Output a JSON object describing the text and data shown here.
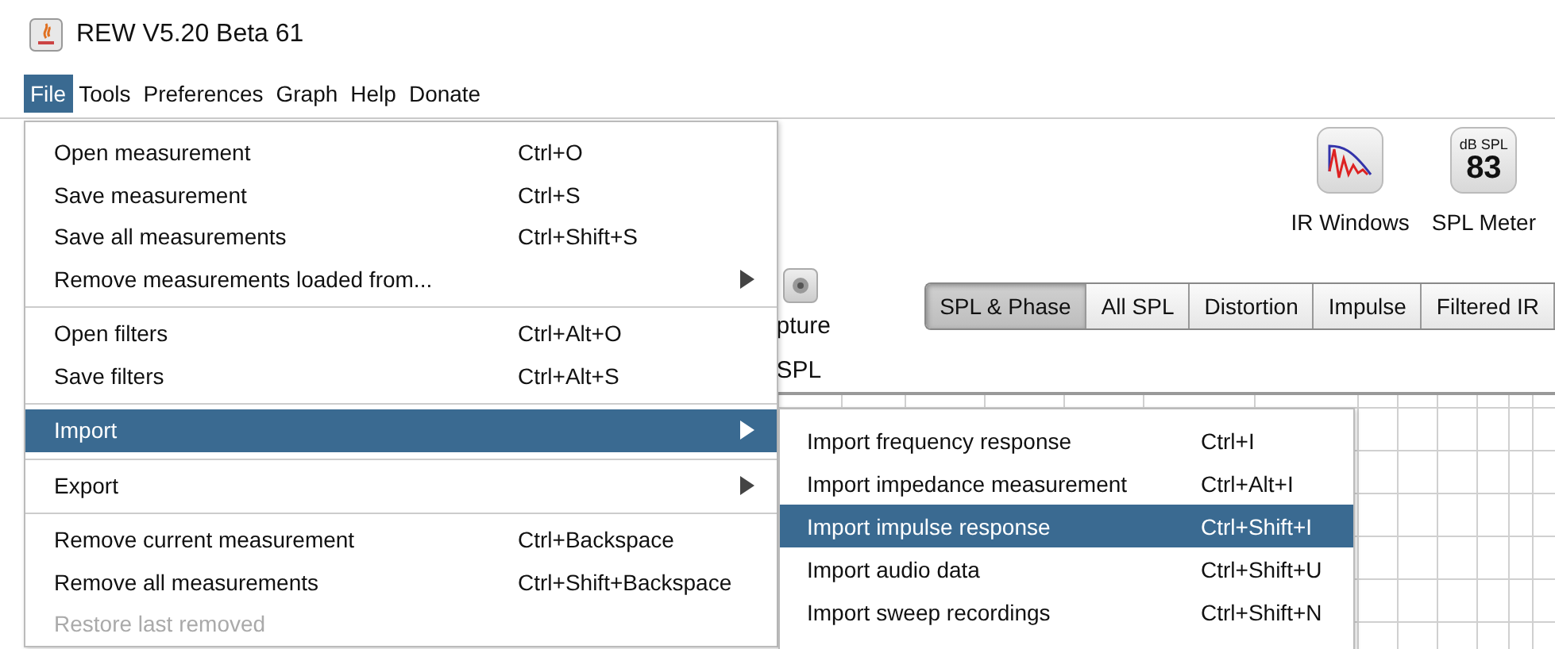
{
  "window": {
    "title": "REW V5.20 Beta 61"
  },
  "menubar": [
    {
      "label": "File",
      "selected": true
    },
    {
      "label": "Tools",
      "selected": false
    },
    {
      "label": "Preferences",
      "selected": false
    },
    {
      "label": "Graph",
      "selected": false
    },
    {
      "label": "Help",
      "selected": false
    },
    {
      "label": "Donate",
      "selected": false
    }
  ],
  "toolbar": {
    "ir_windows": {
      "label": "IR Windows"
    },
    "spl_meter": {
      "label": "SPL Meter",
      "unit": "dB SPL",
      "reading": "83"
    }
  },
  "capture": {
    "label": "pture",
    "sublabel": "SPL"
  },
  "graph_tabs": [
    {
      "label": "SPL & Phase",
      "selected": true
    },
    {
      "label": "All SPL",
      "selected": false
    },
    {
      "label": "Distortion",
      "selected": false
    },
    {
      "label": "Impulse",
      "selected": false
    },
    {
      "label": "Filtered IR",
      "selected": false
    }
  ],
  "file_menu": {
    "groups": [
      [
        {
          "label": "Open measurement",
          "shortcut": "Ctrl+O",
          "submenu": false,
          "selected": false,
          "disabled": false
        },
        {
          "label": "Save measurement",
          "shortcut": "Ctrl+S",
          "submenu": false,
          "selected": false,
          "disabled": false
        },
        {
          "label": "Save all measurements",
          "shortcut": "Ctrl+Shift+S",
          "submenu": false,
          "selected": false,
          "disabled": false
        },
        {
          "label": "Remove measurements loaded from...",
          "submenu": true,
          "selected": false,
          "disabled": false
        }
      ],
      [
        {
          "label": "Open filters",
          "shortcut": "Ctrl+Alt+O",
          "submenu": false,
          "selected": false,
          "disabled": false
        },
        {
          "label": "Save filters",
          "shortcut": "Ctrl+Alt+S",
          "submenu": false,
          "selected": false,
          "disabled": false
        }
      ],
      [
        {
          "label": "Import",
          "submenu": true,
          "selected": true,
          "disabled": false
        }
      ],
      [
        {
          "label": "Export",
          "submenu": true,
          "selected": false,
          "disabled": false
        }
      ],
      [
        {
          "label": "Remove current measurement",
          "shortcut": "Ctrl+Backspace",
          "submenu": false,
          "selected": false,
          "disabled": false
        },
        {
          "label": "Remove all measurements",
          "shortcut": "Ctrl+Shift+Backspace",
          "submenu": false,
          "selected": false,
          "disabled": false
        },
        {
          "label": "Restore last removed",
          "submenu": false,
          "selected": false,
          "disabled": true
        }
      ]
    ]
  },
  "import_menu": [
    {
      "label": "Import frequency response",
      "shortcut": "Ctrl+I",
      "selected": false
    },
    {
      "label": "Import impedance measurement",
      "shortcut": "Ctrl+Alt+I",
      "selected": false
    },
    {
      "label": "Import impulse response",
      "shortcut": "Ctrl+Shift+I",
      "selected": true
    },
    {
      "label": "Import audio data",
      "shortcut": "Ctrl+Shift+U",
      "selected": false
    },
    {
      "label": "Import sweep recordings",
      "shortcut": "Ctrl+Shift+N",
      "selected": false
    }
  ]
}
